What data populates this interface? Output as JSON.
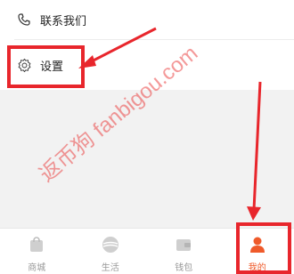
{
  "list": {
    "contact_label": "联系我们",
    "settings_label": "设置"
  },
  "tabbar": {
    "tabs": [
      {
        "label": "商城",
        "icon": "shopping-bag-icon",
        "active": false
      },
      {
        "label": "生活",
        "icon": "planet-icon",
        "active": false
      },
      {
        "label": "钱包",
        "icon": "wallet-icon",
        "active": false
      },
      {
        "label": "我的",
        "icon": "person-icon",
        "active": true
      }
    ]
  },
  "watermark": {
    "text": "返币狗 fanbigou.com"
  },
  "colors": {
    "annotation_red": "#e8262c",
    "active_tab": "#ef5a2a",
    "inactive_tab": "#c9c9c9"
  }
}
